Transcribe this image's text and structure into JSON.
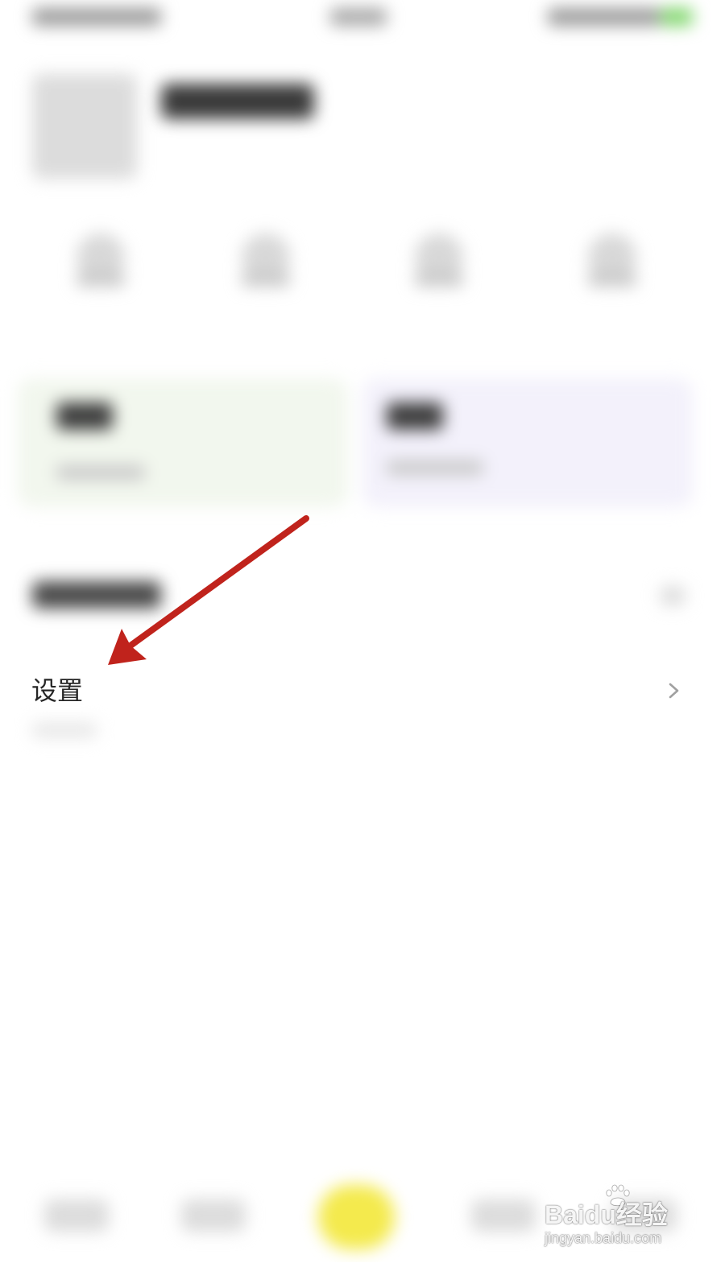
{
  "settings_item": {
    "label": "设置",
    "icon": "chevron-right-icon"
  },
  "annotation": {
    "icon": "red-arrow-icon",
    "color": "#c0231c"
  },
  "watermark": {
    "brand": "Baidu经验",
    "url": "jingyan.baidu.com"
  },
  "colors": {
    "background": "#ffffff",
    "text": "#262626",
    "chevron": "#a0a0a0",
    "tab_center": "#f4ea4d"
  }
}
